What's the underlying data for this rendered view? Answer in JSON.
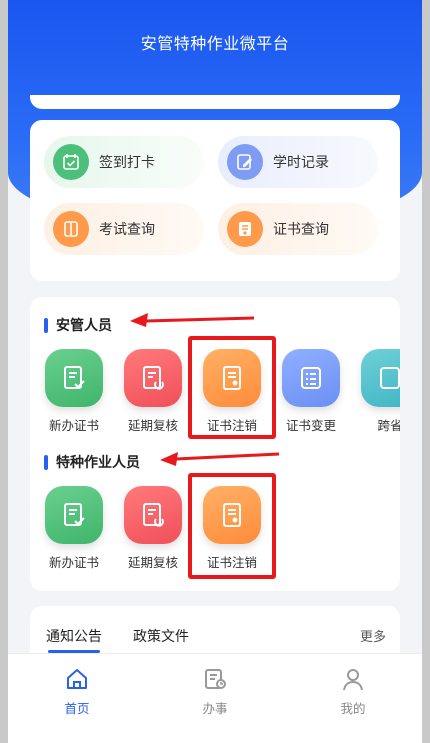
{
  "header": {
    "title": "安管特种作业微平台"
  },
  "quick": [
    {
      "label": "签到打卡",
      "icon": "calendar-check-icon",
      "color": "#4cc07a"
    },
    {
      "label": "学时记录",
      "icon": "pencil-note-icon",
      "color": "#7f9cf5"
    },
    {
      "label": "考试查询",
      "icon": "book-icon",
      "color": "#ff9a4a"
    },
    {
      "label": "证书查询",
      "icon": "certificate-icon",
      "color": "#ff9a4a"
    }
  ],
  "sections": {
    "anguan": {
      "title": "安管人员",
      "items": [
        "新办证书",
        "延期复核",
        "证书注销",
        "证书变更",
        "跨省"
      ]
    },
    "tezhong": {
      "title": "特种作业人员",
      "items": [
        "新办证书",
        "延期复核",
        "证书注销"
      ]
    }
  },
  "notice": {
    "tabs": [
      "通知公告",
      "政策文件"
    ],
    "more": "更多"
  },
  "tabbar": {
    "items": [
      {
        "label": "首页",
        "icon": "home-icon",
        "active": true
      },
      {
        "label": "办事",
        "icon": "tasks-icon",
        "active": false
      },
      {
        "label": "我的",
        "icon": "user-icon",
        "active": false
      }
    ]
  },
  "colors": {
    "primary": "#1a56f0",
    "highlight": "#e8191c"
  }
}
